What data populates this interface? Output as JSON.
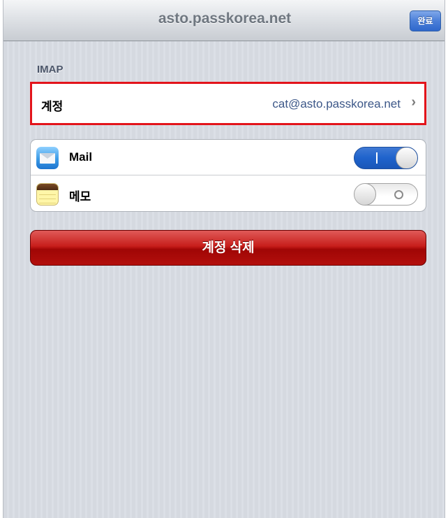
{
  "navbar": {
    "title": "asto.passkorea.net",
    "done_label": "완료"
  },
  "section": {
    "header": "IMAP"
  },
  "account": {
    "label": "계정",
    "value": "cat@asto.passkorea.net",
    "chevron": "›"
  },
  "services": {
    "items": [
      {
        "label": "Mail",
        "icon": "mail-icon",
        "enabled": true
      },
      {
        "label": "메모",
        "icon": "notes-icon",
        "enabled": false
      }
    ]
  },
  "delete_button": {
    "label": "계정 삭제"
  },
  "colors": {
    "highlight_border": "#e3141b",
    "toggle_on": "#1f63cc",
    "delete_red": "#b30f0c",
    "done_blue": "#3f72d2"
  }
}
